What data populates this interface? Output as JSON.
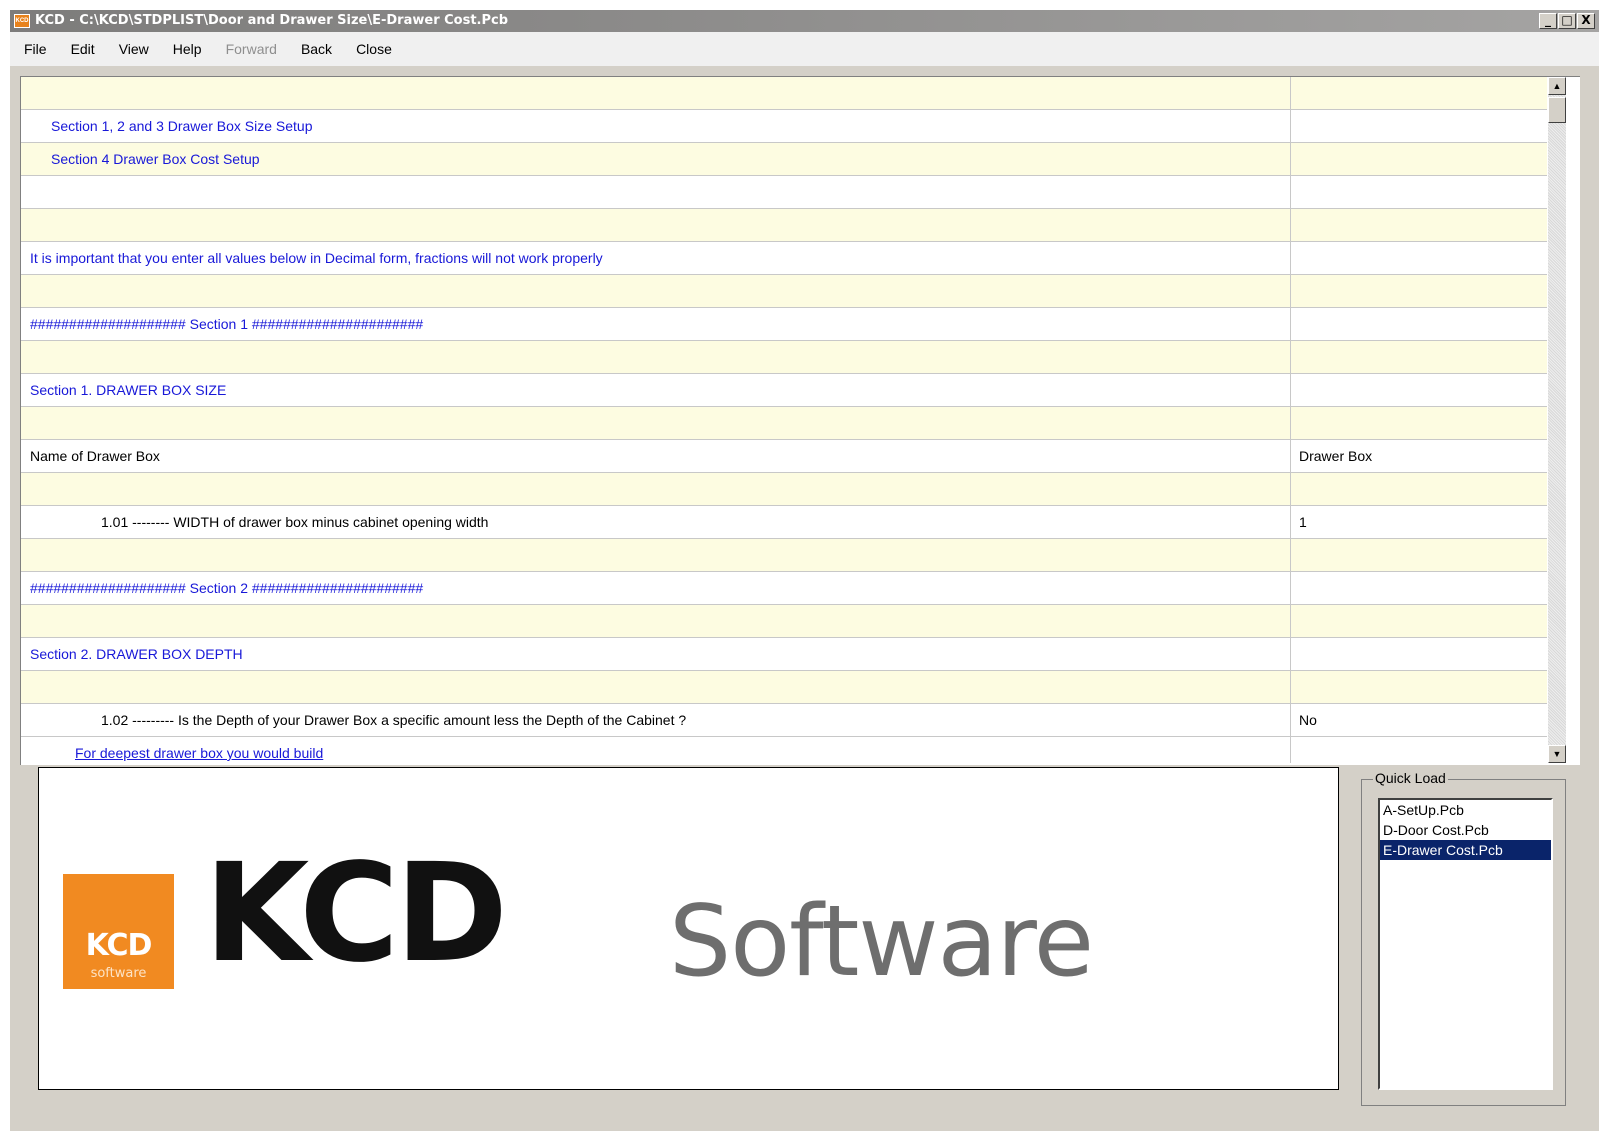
{
  "window": {
    "app_icon_text": "KCD",
    "title": "KCD - C:\\KCD\\STDPLIST\\Door and Drawer Size\\E-Drawer Cost.Pcb",
    "minimize": "_",
    "maximize": "□",
    "close": "X"
  },
  "menu": {
    "file": "File",
    "edit": "Edit",
    "view": "View",
    "help": "Help",
    "forward": "Forward",
    "back": "Back",
    "close": "Close"
  },
  "grid": {
    "rows": [
      {
        "text": "",
        "value": ""
      },
      {
        "text": "Section 1, 2 and 3 Drawer Box Size Setup",
        "value": ""
      },
      {
        "text": "Section 4 Drawer Box Cost Setup",
        "value": ""
      },
      {
        "text": "",
        "value": ""
      },
      {
        "text": "",
        "value": ""
      },
      {
        "text": "It is important that you enter all values below in Decimal form, fractions will not work properly",
        "value": ""
      },
      {
        "text": "",
        "value": ""
      },
      {
        "text": "#################### Section 1 ######################",
        "value": ""
      },
      {
        "text": "",
        "value": ""
      },
      {
        "text": "Section 1.  DRAWER BOX SIZE",
        "value": ""
      },
      {
        "text": "",
        "value": ""
      },
      {
        "text": "Name of Drawer Box",
        "value": "Drawer Box"
      },
      {
        "text": "",
        "value": ""
      },
      {
        "text": "1.01 -------- WIDTH of drawer box minus cabinet opening width",
        "value": "1"
      },
      {
        "text": "",
        "value": ""
      },
      {
        "text": "#################### Section 2 ######################",
        "value": ""
      },
      {
        "text": "",
        "value": ""
      },
      {
        "text": "Section 2.  DRAWER BOX DEPTH",
        "value": ""
      },
      {
        "text": "",
        "value": ""
      },
      {
        "text": "1.02 --------- Is the Depth of your Drawer Box a specific amount less the Depth of the Cabinet ?",
        "value": "No"
      },
      {
        "text": "For deepest drawer box you would build",
        "value": ""
      }
    ]
  },
  "logo": {
    "square_mark": "KCD",
    "square_sub": "software",
    "wordmark_bold": "KCD",
    "wordmark_light": "Software"
  },
  "quick_load": {
    "label": "Quick Load",
    "items": [
      "A-SetUp.Pcb",
      "D-Door Cost.Pcb",
      "E-Drawer Cost.Pcb"
    ],
    "selected": "E-Drawer Cost.Pcb"
  },
  "colors": {
    "link_blue": "#1818d8",
    "row_yellow": "#fdfce1",
    "selection": "#0a246a",
    "logo_orange": "#f18a21"
  }
}
